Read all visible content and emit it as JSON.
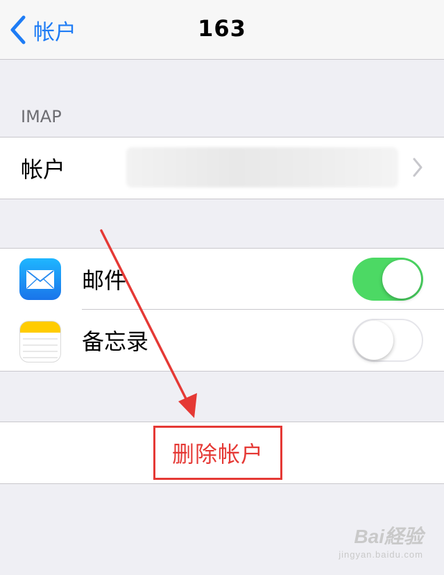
{
  "navbar": {
    "back_label": "帐户",
    "title": "163"
  },
  "section": {
    "header": "IMAP"
  },
  "account_row": {
    "label": "帐户"
  },
  "apps": [
    {
      "label": "邮件",
      "icon": "mail-icon",
      "enabled": true
    },
    {
      "label": "备忘录",
      "icon": "notes-icon",
      "enabled": false
    }
  ],
  "delete_account": {
    "label": "删除帐户"
  },
  "watermark": {
    "brand": "Bai経验",
    "url": "jingyan.baidu.com"
  },
  "colors": {
    "accent": "#1e7cf5",
    "switch_on": "#4cd964",
    "danger": "#e53935",
    "background": "#efeff4"
  }
}
